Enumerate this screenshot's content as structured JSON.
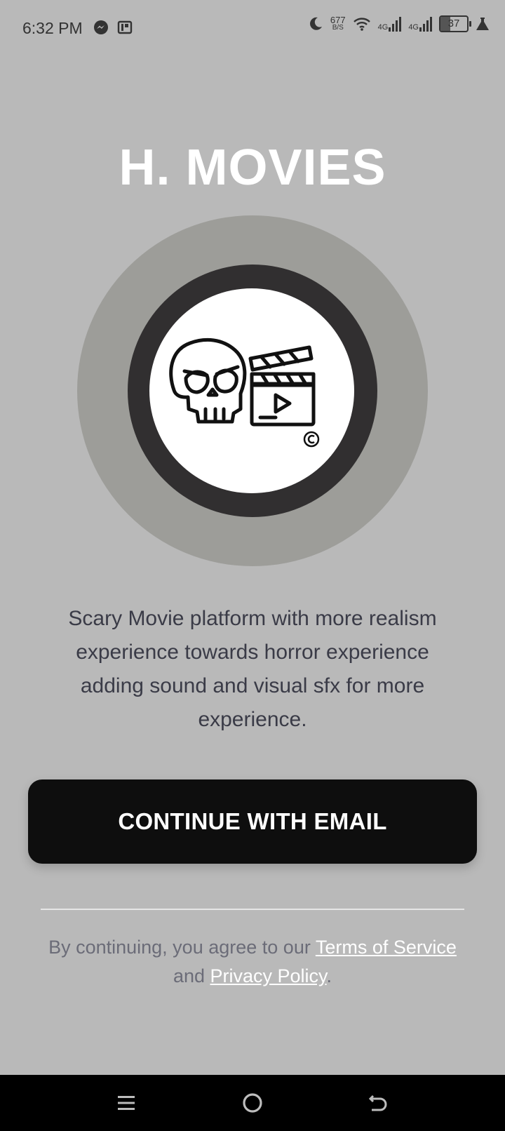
{
  "status_bar": {
    "time": "6:32 PM",
    "left_icons": [
      "messenger-icon",
      "app-notification-icon"
    ],
    "net_speed_value": "677",
    "net_speed_unit": "B/S",
    "signal1_label": "4G",
    "signal2_label": "4G",
    "battery": "37",
    "right_icons": [
      "moon-icon",
      "wifi-icon",
      "signal-icon",
      "battery-icon",
      "alert-icon"
    ]
  },
  "app": {
    "title": "H. MOVIES",
    "logo_icons": [
      "skull-icon",
      "clapperboard-icon",
      "copyright-icon"
    ],
    "description": "Scary Movie platform with more realism experience towards horror experience adding sound and visual sfx for more experience.",
    "cta_label": "CONTINUE WITH EMAIL",
    "legal_prefix": "By continuing, you agree to our ",
    "terms_label": "Terms of Service",
    "legal_middle": " and ",
    "privacy_label": "Privacy Policy",
    "legal_suffix": "."
  },
  "nav_bar": {
    "icons": [
      "menu-icon",
      "home-icon",
      "back-icon"
    ]
  },
  "colors": {
    "background": "#b9b9b9",
    "title": "#ffffff",
    "button": "#0e0e0e",
    "description": "#3a3b47",
    "logo_outer": "#9d9d99",
    "logo_ring": "#312f30"
  }
}
